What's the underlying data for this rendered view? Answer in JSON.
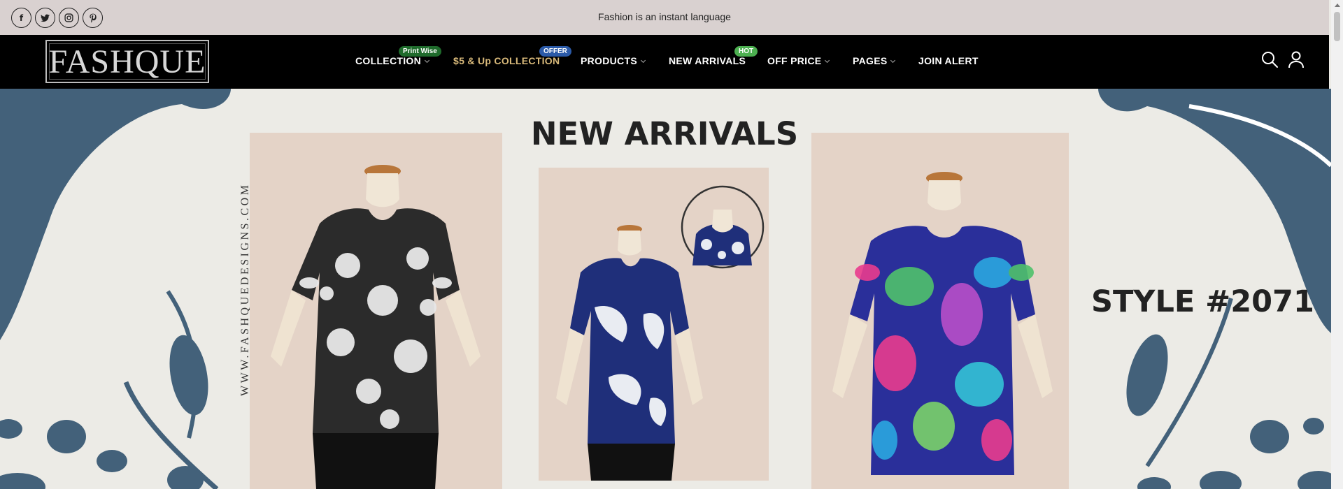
{
  "topbar": {
    "tagline": "Fashion is an instant language",
    "socials": [
      {
        "icon": "facebook-icon",
        "glyph": "f"
      },
      {
        "icon": "twitter-icon",
        "glyph": "t"
      },
      {
        "icon": "instagram-icon",
        "glyph": "◎"
      },
      {
        "icon": "pinterest-icon",
        "glyph": "p"
      }
    ]
  },
  "nav": {
    "logo": "FASHQUE",
    "items": [
      {
        "label": "COLLECTION",
        "badge": "Print Wise",
        "badge_color": "#1f6b2c",
        "dropdown": true
      },
      {
        "label": "$5 & Up COLLECTION",
        "badge": "OFFER",
        "badge_color": "#2b5aa8",
        "dropdown": false
      },
      {
        "label": "PRODUCTS",
        "dropdown": true
      },
      {
        "label": "NEW ARRIVALS",
        "badge": "HOT",
        "badge_color": "#4caf50",
        "dropdown": false
      },
      {
        "label": "OFF PRICE",
        "dropdown": true
      },
      {
        "label": "PAGES",
        "dropdown": true
      },
      {
        "label": "JOIN ALERT",
        "dropdown": false
      }
    ]
  },
  "hero": {
    "title": "NEW ARRIVALS",
    "style": "STYLE #2071",
    "website": "WWW.FASHQUEDESIGNS.COM",
    "shape_color": "#43617a"
  },
  "colors": {
    "topbar_bg": "#d9d1d0",
    "nav_bg": "#000000",
    "hero_bg": "#ecebe6",
    "photo_bg": "#e4d3c7"
  }
}
